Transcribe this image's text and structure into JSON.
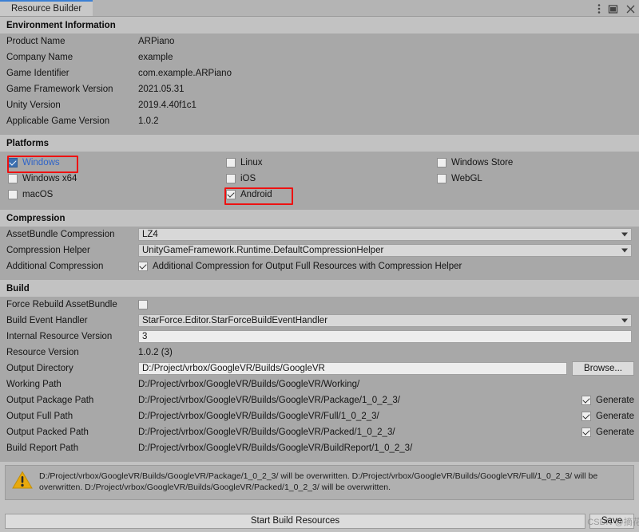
{
  "window": {
    "tab_label": "Resource Builder",
    "controls": {
      "menu": "kebab-menu-icon",
      "maximize": "maximize-icon",
      "close": "close-icon"
    },
    "accent": "#3b7fd4"
  },
  "environment": {
    "heading": "Environment Information",
    "rows": [
      {
        "label": "Product Name",
        "value": "ARPiano"
      },
      {
        "label": "Company Name",
        "value": "example"
      },
      {
        "label": "Game Identifier",
        "value": "com.example.ARPiano"
      },
      {
        "label": "Game Framework Version",
        "value": "2021.05.31"
      },
      {
        "label": "Unity Version",
        "value": "2019.4.40f1c1"
      },
      {
        "label": "Applicable Game Version",
        "value": "1.0.2"
      }
    ]
  },
  "platforms": {
    "heading": "Platforms",
    "column1": [
      {
        "label": "Windows",
        "checked": true,
        "selected": true,
        "highlighted": true
      },
      {
        "label": "Windows x64",
        "checked": false,
        "selected": false,
        "highlighted": false
      },
      {
        "label": "macOS",
        "checked": false,
        "selected": false,
        "highlighted": false
      }
    ],
    "column2": [
      {
        "label": "Linux",
        "checked": false,
        "selected": false,
        "highlighted": false
      },
      {
        "label": "iOS",
        "checked": false,
        "selected": false,
        "highlighted": false
      },
      {
        "label": "Android",
        "checked": true,
        "selected": false,
        "highlighted": true
      }
    ],
    "column3": [
      {
        "label": "Windows Store",
        "checked": false,
        "selected": false,
        "highlighted": false
      },
      {
        "label": "WebGL",
        "checked": false,
        "selected": false,
        "highlighted": false
      }
    ],
    "highlight_color": "#ee1111"
  },
  "compression": {
    "heading": "Compression",
    "assetbundle_label": "AssetBundle Compression",
    "assetbundle_value": "LZ4",
    "helper_label": "Compression Helper",
    "helper_value": "UnityGameFramework.Runtime.DefaultCompressionHelper",
    "additional_label": "Additional Compression",
    "additional_checkbox_label": "Additional Compression for Output Full Resources with Compression Helper",
    "additional_checked": true
  },
  "build": {
    "heading": "Build",
    "force_rebuild_label": "Force Rebuild AssetBundle",
    "force_rebuild_checked": false,
    "event_handler_label": "Build Event Handler",
    "event_handler_value": "StarForce.Editor.StarForceBuildEventHandler",
    "internal_version_label": "Internal Resource Version",
    "internal_version_value": "3",
    "resource_version_label": "Resource Version",
    "resource_version_value": "1.0.2 (3)",
    "output_dir_label": "Output Directory",
    "output_dir_value": "D:/Project/vrbox/GoogleVR/Builds/GoogleVR",
    "browse_label": "Browse...",
    "paths": [
      {
        "label": "Working Path",
        "value": "D:/Project/vrbox/GoogleVR/Builds/GoogleVR/Working/",
        "generate": null,
        "generate_label": ""
      },
      {
        "label": "Output Package Path",
        "value": "D:/Project/vrbox/GoogleVR/Builds/GoogleVR/Package/1_0_2_3/",
        "generate": true,
        "generate_label": "Generate"
      },
      {
        "label": "Output Full Path",
        "value": "D:/Project/vrbox/GoogleVR/Builds/GoogleVR/Full/1_0_2_3/",
        "generate": true,
        "generate_label": "Generate"
      },
      {
        "label": "Output Packed Path",
        "value": "D:/Project/vrbox/GoogleVR/Builds/GoogleVR/Packed/1_0_2_3/",
        "generate": true,
        "generate_label": "Generate"
      },
      {
        "label": "Build Report Path",
        "value": "D:/Project/vrbox/GoogleVR/Builds/GoogleVR/BuildReport/1_0_2_3/",
        "generate": null,
        "generate_label": ""
      }
    ]
  },
  "warning": {
    "icon": "warning-triangle-icon",
    "color": "#e8a90c",
    "text": "D:/Project/vrbox/GoogleVR/Builds/GoogleVR/Package/1_0_2_3/ will be overwritten. D:/Project/vrbox/GoogleVR/Builds/GoogleVR/Full/1_0_2_3/ will be overwritten. D:/Project/vrbox/GoogleVR/Builds/GoogleVR/Packed/1_0_2_3/ will be overwritten."
  },
  "footer": {
    "start_label": "Start Build Resources",
    "save_label": "Save",
    "watermark": "CSDN @摘花"
  }
}
